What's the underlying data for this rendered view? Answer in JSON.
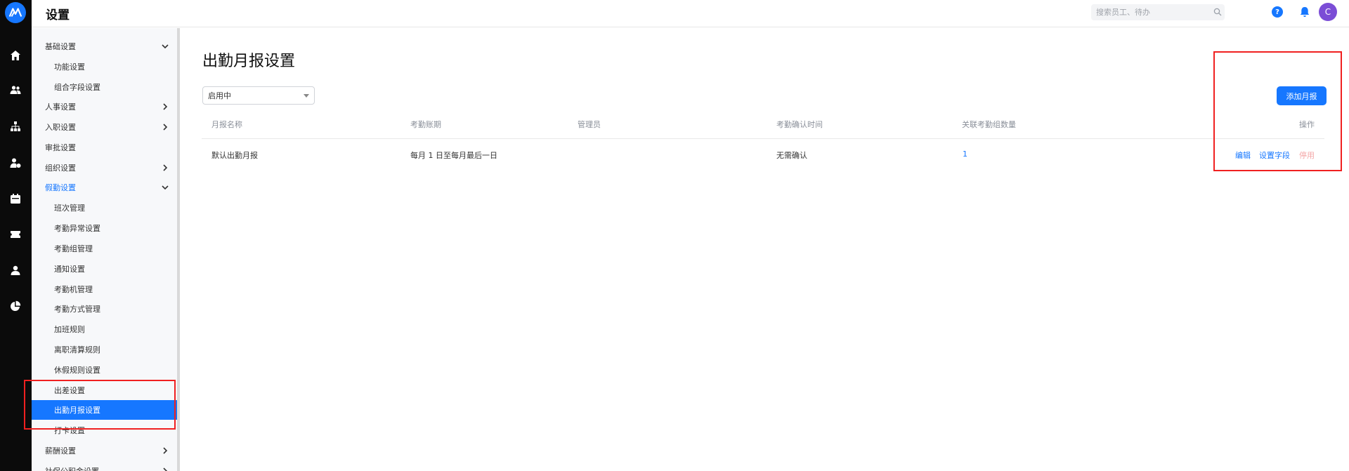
{
  "app": {
    "logo_text": "M"
  },
  "rail": {
    "icons": [
      "home-icon",
      "team-icon",
      "org-icon",
      "user-admin-icon",
      "calendar-icon",
      "ticket-icon",
      "profile-icon",
      "pie-chart-icon"
    ]
  },
  "header": {
    "title": "设置",
    "search_placeholder": "搜索员工、待办",
    "help_label": "?",
    "avatar_initial": "C"
  },
  "sidebar": {
    "items": [
      {
        "label": "基础设置",
        "level": 1,
        "chevron": "down"
      },
      {
        "label": "功能设置",
        "level": 2
      },
      {
        "label": "组合字段设置",
        "level": 2
      },
      {
        "label": "人事设置",
        "level": 1,
        "chevron": "right"
      },
      {
        "label": "入职设置",
        "level": 1,
        "chevron": "right"
      },
      {
        "label": "审批设置",
        "level": 1
      },
      {
        "label": "组织设置",
        "level": 1,
        "chevron": "right"
      },
      {
        "label": "假勤设置",
        "level": 1,
        "chevron": "down",
        "state": "expanded-blue"
      },
      {
        "label": "班次管理",
        "level": 2
      },
      {
        "label": "考勤异常设置",
        "level": 2
      },
      {
        "label": "考勤组管理",
        "level": 2
      },
      {
        "label": "通知设置",
        "level": 2
      },
      {
        "label": "考勤机管理",
        "level": 2
      },
      {
        "label": "考勤方式管理",
        "level": 2
      },
      {
        "label": "加班规则",
        "level": 2
      },
      {
        "label": "离职清算规则",
        "level": 2
      },
      {
        "label": "休假规则设置",
        "level": 2
      },
      {
        "label": "出差设置",
        "level": 2
      },
      {
        "label": "出勤月报设置",
        "level": 2,
        "state": "active"
      },
      {
        "label": "打卡设置",
        "level": 2
      },
      {
        "label": "薪酬设置",
        "level": 1,
        "chevron": "right"
      },
      {
        "label": "社保公积金设置",
        "level": 1,
        "chevron": "right"
      }
    ]
  },
  "main": {
    "title": "出勤月报设置",
    "status_filter": "启用中",
    "add_button": "添加月报",
    "table": {
      "columns": [
        "月报名称",
        "考勤账期",
        "管理员",
        "考勤确认时间",
        "关联考勤组数量",
        "操作"
      ],
      "rows": [
        {
          "name": "默认出勤月报",
          "period": "每月 1 日至每月最后一日",
          "admin": "",
          "confirm_time": "无需确认",
          "group_count": "1",
          "actions": [
            "编辑",
            "设置字段",
            "停用"
          ]
        }
      ]
    }
  },
  "colors": {
    "accent": "#1677ff",
    "rail_bg": "#0b0b0b",
    "sidebar_bg": "#f7f8fa",
    "highlight_box": "#f02020",
    "avatar": "#7b4dd6"
  }
}
